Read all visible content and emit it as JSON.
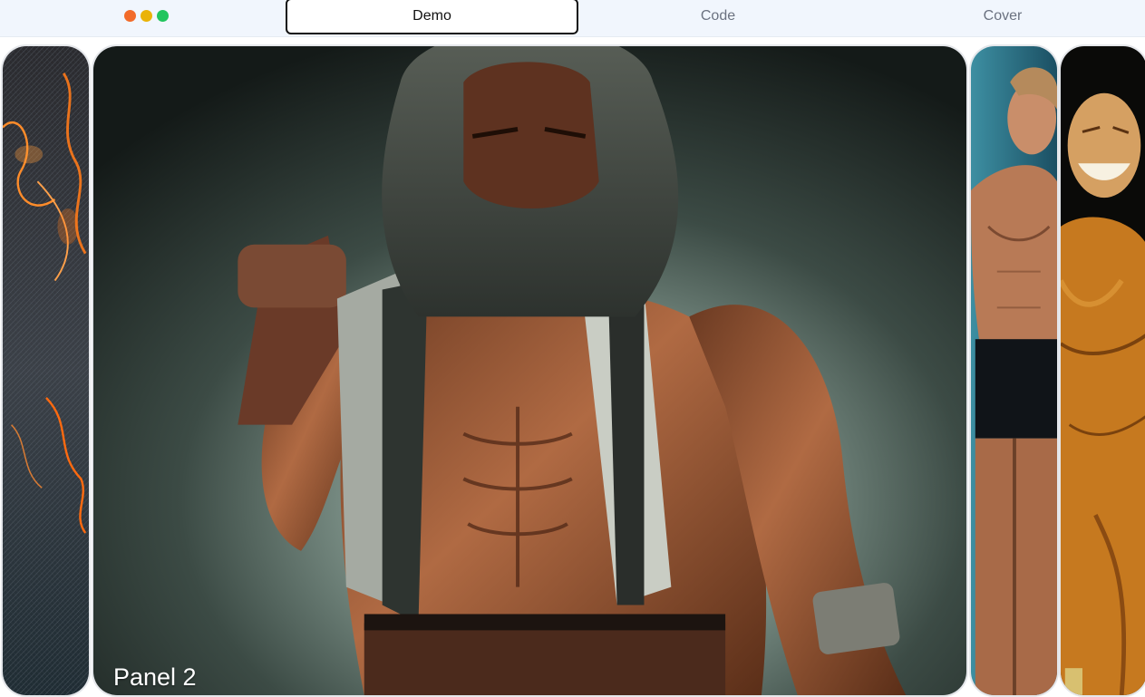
{
  "window": {
    "dots": [
      {
        "name": "close-dot",
        "color": "#f26b2a"
      },
      {
        "name": "minimize-dot",
        "color": "#eab308"
      },
      {
        "name": "maximize-dot",
        "color": "#22c55e"
      }
    ]
  },
  "tabs": [
    {
      "id": "demo",
      "label": "Demo",
      "active": true
    },
    {
      "id": "code",
      "label": "Code",
      "active": false
    },
    {
      "id": "cover",
      "label": "Cover",
      "active": false
    }
  ],
  "panels": [
    {
      "id": "panel-1",
      "image": "fiery-textured-face-artwork",
      "label": "",
      "expanded": false
    },
    {
      "id": "panel-2",
      "image": "hooded-muscular-fighter-photo",
      "label": "Panel 2",
      "expanded": true
    },
    {
      "id": "panel-3",
      "image": "young-bodybuilder-posing-photo",
      "label": "",
      "expanded": false
    },
    {
      "id": "panel-4",
      "image": "bald-bodybuilder-flexing-photo",
      "label": "",
      "expanded": false
    }
  ],
  "colors": {
    "topbar_bg": "#f1f6fd",
    "active_tab_border": "#111111",
    "inactive_tab_text": "#6b7280"
  }
}
